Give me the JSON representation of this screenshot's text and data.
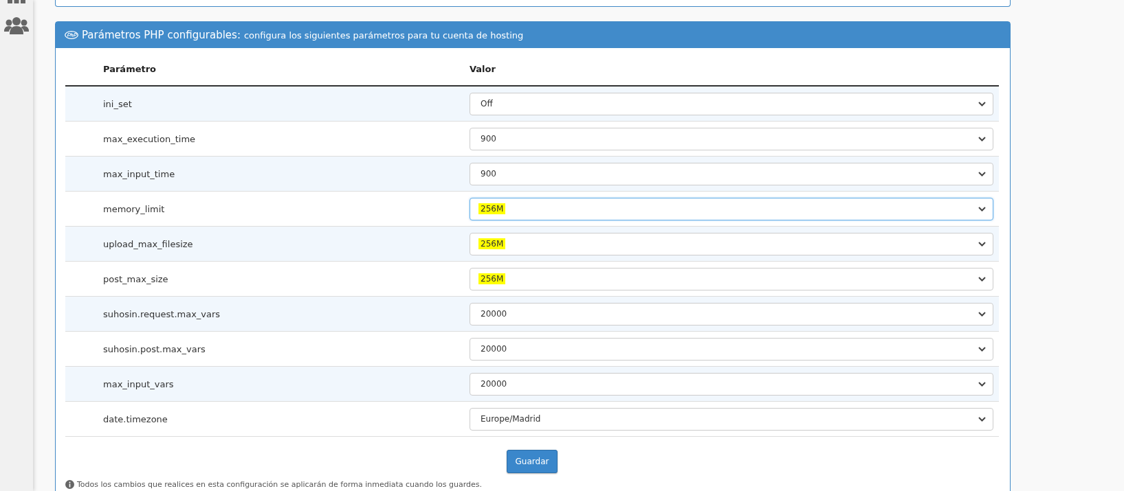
{
  "panel": {
    "title": "Parámetros PHP configurables:",
    "subtitle": "configura los siguientes parámetros para tu cuenta de hosting"
  },
  "table": {
    "columns": [
      "Parámetro",
      "Valor"
    ],
    "rows": [
      {
        "parameter": "ini_set",
        "value": "Off",
        "highlighted": false,
        "focused": false
      },
      {
        "parameter": "max_execution_time",
        "value": "900",
        "highlighted": false,
        "focused": false
      },
      {
        "parameter": "max_input_time",
        "value": "900",
        "highlighted": false,
        "focused": false
      },
      {
        "parameter": "memory_limit",
        "value": "256M",
        "highlighted": true,
        "focused": true
      },
      {
        "parameter": "upload_max_filesize",
        "value": "256M",
        "highlighted": true,
        "focused": false
      },
      {
        "parameter": "post_max_size",
        "value": "256M",
        "highlighted": true,
        "focused": false
      },
      {
        "parameter": "suhosin.request.max_vars",
        "value": "20000",
        "highlighted": false,
        "focused": false
      },
      {
        "parameter": "suhosin.post.max_vars",
        "value": "20000",
        "highlighted": false,
        "focused": false
      },
      {
        "parameter": "max_input_vars",
        "value": "20000",
        "highlighted": false,
        "focused": false
      },
      {
        "parameter": "date.timezone",
        "value": "Europe/Madrid",
        "highlighted": false,
        "focused": false
      }
    ]
  },
  "save_button": "Guardar",
  "note": "Todos los cambios que realices en esta configuración se aplicarán de forma inmediata cuando los guardes."
}
